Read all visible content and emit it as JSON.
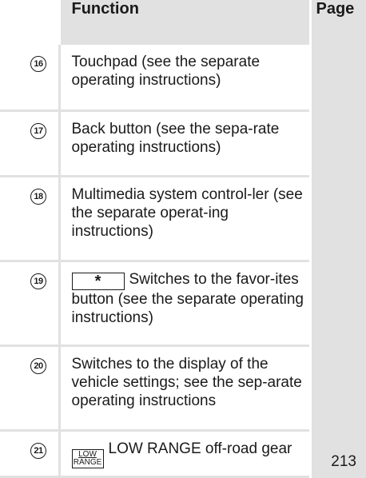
{
  "header": {
    "function": "Function",
    "page": "Page"
  },
  "rows": [
    {
      "num": "16",
      "desc": "Touchpad (see the separate operating instructions)",
      "page": ""
    },
    {
      "num": "17",
      "desc": "Back button (see the sepa-rate operating instructions)",
      "page": ""
    },
    {
      "num": "18",
      "desc": "Multimedia system control-ler (see the separate operat-ing instructions)",
      "page": ""
    },
    {
      "num": "19",
      "key": "*",
      "desc": "Switches to the favor-ites button (see the separate operating instructions)",
      "page": ""
    },
    {
      "num": "20",
      "desc": "Switches to the display of the vehicle settings; see the sep-arate operating instructions",
      "page": ""
    },
    {
      "num": "21",
      "key_top": "LOW",
      "key_bottom": "RANGE",
      "desc": "LOW RANGE off-road gear",
      "page": "213"
    }
  ]
}
